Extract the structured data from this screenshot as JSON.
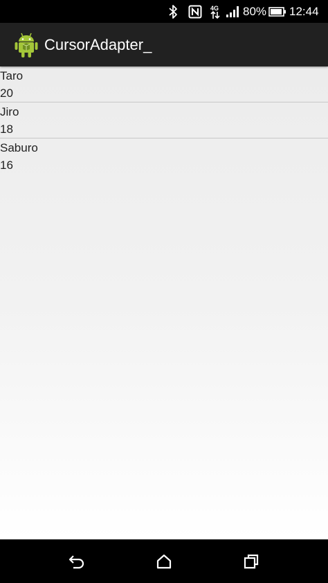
{
  "status_bar": {
    "battery_percent": "80%",
    "time": "12:44",
    "icons": [
      "bluetooth-icon",
      "nfc-icon",
      "4g-data-icon",
      "signal-icon",
      "battery-icon"
    ]
  },
  "action_bar": {
    "title": "CursorAdapter_",
    "app_icon": "android-icon"
  },
  "list": {
    "items": [
      {
        "name": "Taro",
        "age": "20"
      },
      {
        "name": "Jiro",
        "age": "18"
      },
      {
        "name": "Saburo",
        "age": "16"
      }
    ]
  },
  "nav_bar": {
    "buttons": [
      "back-icon",
      "home-icon",
      "recents-icon"
    ]
  },
  "colors": {
    "status_bar_bg": "#000000",
    "action_bar_bg": "#212121",
    "android_green": "#a4c639",
    "text": "#222222"
  }
}
